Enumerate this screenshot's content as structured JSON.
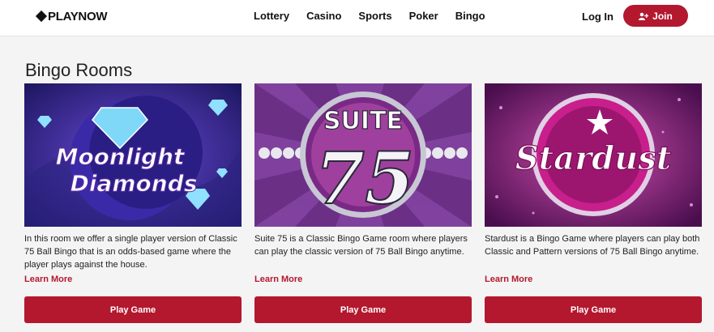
{
  "header": {
    "logo": "PLAYNOW",
    "nav": [
      "Lottery",
      "Casino",
      "Sports",
      "Poker",
      "Bingo"
    ],
    "login_label": "Log In",
    "join_label": "Join"
  },
  "main": {
    "title": "Bingo Rooms",
    "cards": [
      {
        "art_text": [
          "Moonlight",
          "Diamonds"
        ],
        "description": "In this room we offer a single player version of Classic 75 Ball Bingo that is an odds-based game where the player plays against the house.",
        "learn_more": "Learn More",
        "play_label": "Play Game"
      },
      {
        "art_text": [
          "SUITE",
          "75"
        ],
        "description": "Suite 75 is a Classic Bingo Game room where players can play the classic version of 75 Ball Bingo anytime.",
        "learn_more": "Learn More",
        "play_label": "Play Game"
      },
      {
        "art_text": [
          "Stardust"
        ],
        "description": "Stardust is a Bingo Game where players can play both Classic and Pattern versions of 75 Ball Bingo anytime.",
        "learn_more": "Learn More",
        "play_label": "Play Game"
      }
    ]
  },
  "colors": {
    "brand": "#b3182e",
    "background": "#f4f4f4"
  },
  "icons": {
    "logo_mark": "diamond-icon",
    "join": "add-user-icon"
  }
}
